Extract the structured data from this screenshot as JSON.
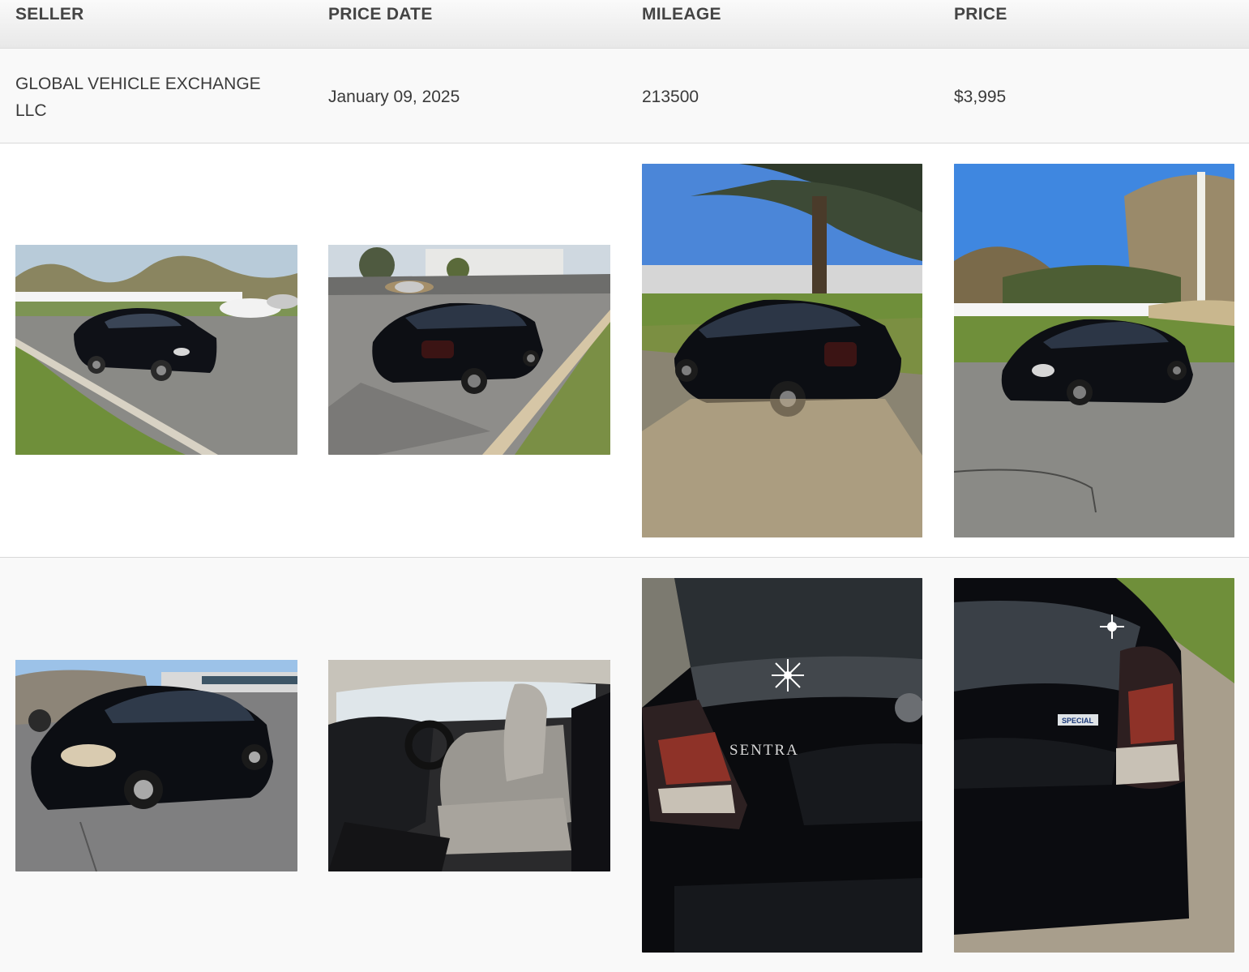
{
  "table": {
    "headers": [
      "SELLER",
      "PRICE DATE",
      "MILEAGE",
      "PRICE"
    ],
    "row": {
      "seller": "GLOBAL VEHICLE EXCHANGE LLC",
      "price_date": "January 09, 2025",
      "mileage": "213500",
      "price": "$3,995"
    }
  },
  "photos": [
    {
      "subject": "black sedan front three-quarter view, parking lot with white fence"
    },
    {
      "subject": "black sedan rear three-quarter view, parking lot with building"
    },
    {
      "subject": "black sedan rear view under tree"
    },
    {
      "subject": "black sedan front view, field and white fence"
    },
    {
      "subject": "black sedan front three-quarter view, auction lot"
    },
    {
      "subject": "interior with grey front seats, open driver door"
    },
    {
      "subject": "close-up of trunk with SENTRA badge"
    },
    {
      "subject": "close-up of trunk with SPECIAL badge"
    }
  ],
  "badges": {
    "sentra": "SENTRA",
    "special": "SPECIAL"
  }
}
